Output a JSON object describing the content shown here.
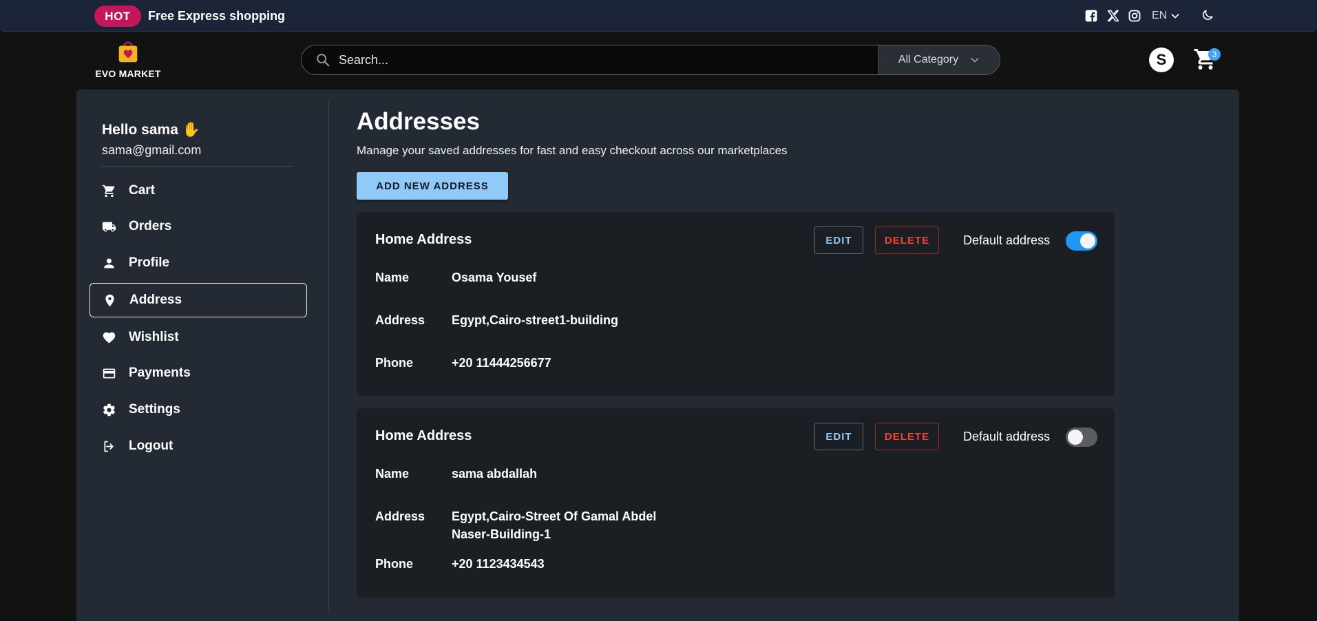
{
  "topbar": {
    "badge": "HOT",
    "promo": "Free Express shopping",
    "language": "EN",
    "social_icons": [
      "facebook-icon",
      "x-icon",
      "instagram-icon"
    ]
  },
  "header": {
    "logo_text": "EVO MARKET",
    "search_placeholder": "Search...",
    "category_select": "All Category",
    "avatar_letter": "S",
    "cart_count": "3"
  },
  "user": {
    "greeting": "Hello sama ✋",
    "email": "sama@gmail.com"
  },
  "sidebar": {
    "items": [
      {
        "label": "Cart",
        "icon": "cart-icon"
      },
      {
        "label": "Orders",
        "icon": "truck-icon"
      },
      {
        "label": "Profile",
        "icon": "person-icon"
      },
      {
        "label": "Address",
        "icon": "location-pin-icon",
        "active": true
      },
      {
        "label": "Wishlist",
        "icon": "heart-icon"
      },
      {
        "label": "Payments",
        "icon": "credit-card-icon"
      },
      {
        "label": "Settings",
        "icon": "gear-icon"
      },
      {
        "label": "Logout",
        "icon": "logout-icon"
      }
    ]
  },
  "main": {
    "title": "Addresses",
    "subtitle": "Manage your saved addresses for fast and easy checkout across our marketplaces",
    "add_button": "ADD NEW ADDRESS",
    "field_labels": {
      "name": "Name",
      "address": "Address",
      "phone": "Phone"
    },
    "edit_label": "EDIT",
    "delete_label": "DELETE",
    "default_label": "Default address",
    "addresses": [
      {
        "title": "Home Address",
        "name": "Osama Yousef",
        "address_line1": "Egypt,Cairo-street1-building",
        "address_line2": "",
        "phone": "+20 11444256677",
        "is_default": true
      },
      {
        "title": "Home Address",
        "name": "sama abdallah",
        "address_line1": "Egypt,Cairo-Street Of Gamal Abdel",
        "address_line2": "Naser-Building-1",
        "phone": "+20 1123434543",
        "is_default": false
      }
    ]
  },
  "colors": {
    "background": "#121212",
    "topbar": "#1c2537",
    "panel": "#232a33",
    "card": "#1b1f24",
    "accent": "#90caf9",
    "toggle_on": "#2196f3",
    "badge": "#c2185b",
    "danger": "#f44336"
  }
}
